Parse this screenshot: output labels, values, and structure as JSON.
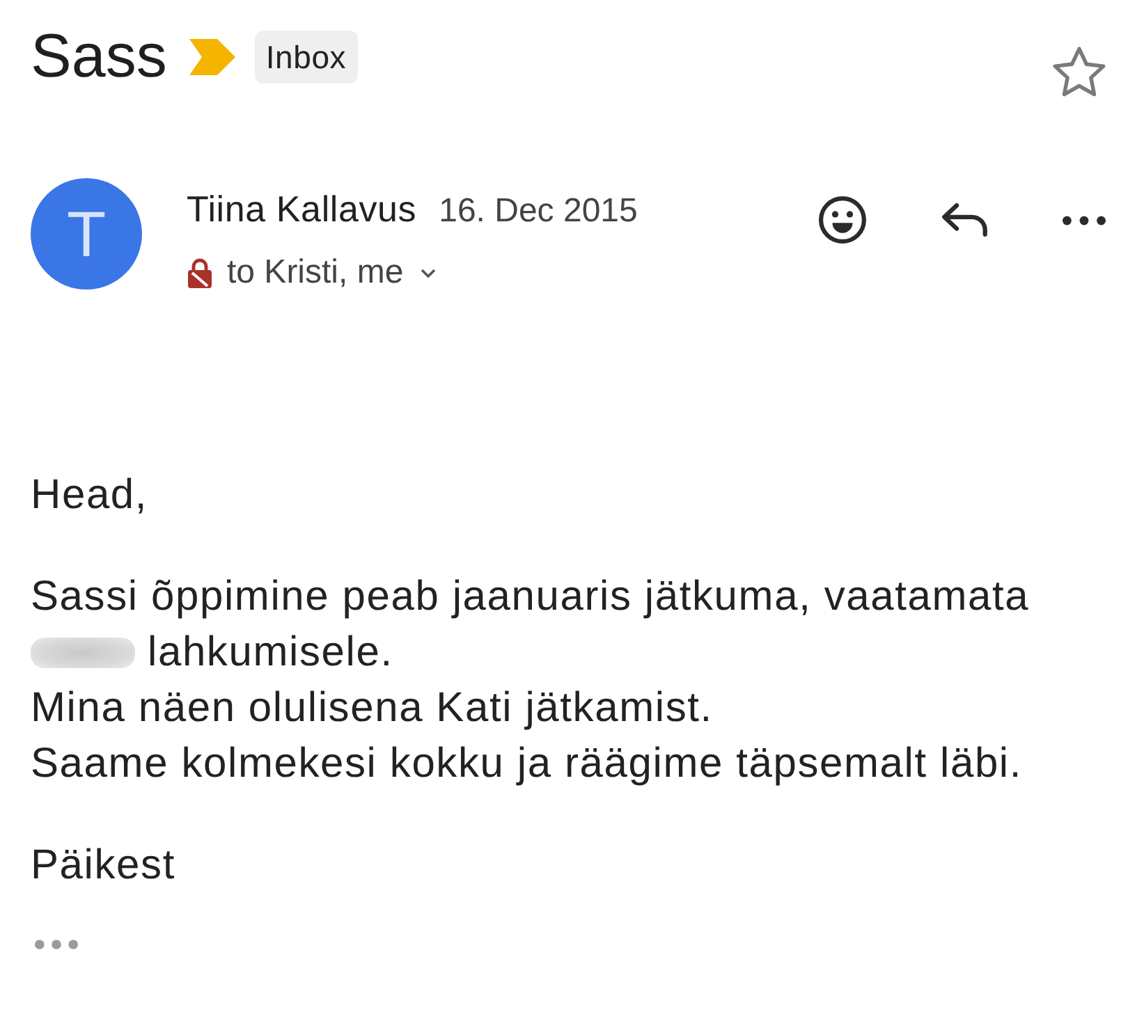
{
  "subject": {
    "title": "Sass",
    "important": true,
    "label": "Inbox",
    "starred": false
  },
  "message": {
    "avatar_initial": "T",
    "sender": "Tiina Kallavus",
    "date": "16. Dec 2015",
    "unencrypted_warning": true,
    "recipients": "to Kristi, me",
    "body": [
      {
        "lines": [
          {
            "kind": "text",
            "text": "Head,"
          }
        ]
      },
      {
        "lines": [
          {
            "kind": "text",
            "text": "Sassi õppimine peab jaanuaris jätkuma, vaatamata"
          },
          {
            "kind": "redacted_lead",
            "text": "lahkumisele."
          },
          {
            "kind": "text",
            "text": "Mina näen olulisena Kati jätkamist."
          },
          {
            "kind": "text",
            "text": "Saame kolmekesi kokku ja räägime täpsemalt läbi."
          }
        ]
      },
      {
        "lines": [
          {
            "kind": "text",
            "text": "Päikest"
          }
        ]
      }
    ],
    "trimmed_content": true
  }
}
